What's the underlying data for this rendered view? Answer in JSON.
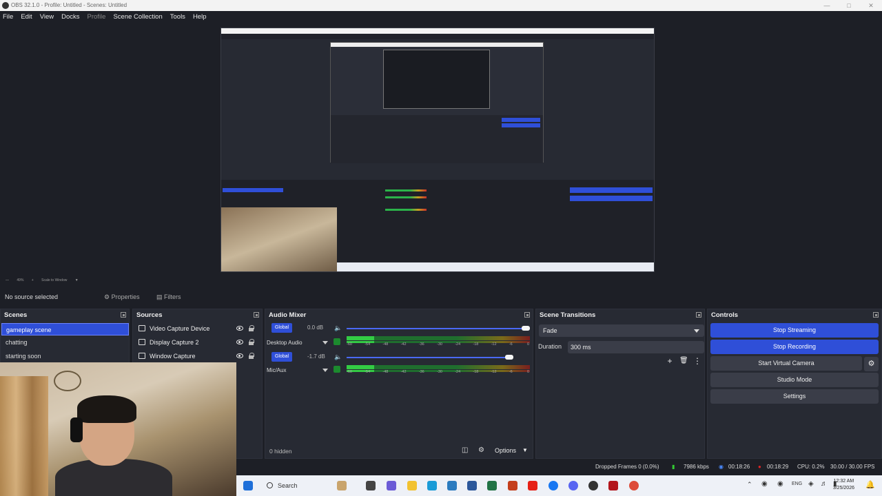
{
  "window": {
    "title": "OBS 32.1.0 - Profile: Untitled - Scenes: Untitled"
  },
  "menu": {
    "file": "File",
    "edit": "Edit",
    "view": "View",
    "docks": "Docks",
    "profile": "Profile",
    "scene_collection": "Scene Collection",
    "tools": "Tools",
    "help": "Help"
  },
  "zoom": {
    "level": "49%",
    "scale_mode": "Scale to Window"
  },
  "context": {
    "no_source": "No source selected",
    "properties": "Properties",
    "filters": "Filters"
  },
  "scenes": {
    "title": "Scenes",
    "items": [
      "gameplay scene",
      "chatting",
      "starting soon"
    ],
    "selected": "gameplay scene"
  },
  "sources": {
    "title": "Sources",
    "items": [
      "Video Capture Device",
      "Display Capture 2",
      "Window Capture"
    ]
  },
  "mixer": {
    "title": "Audio Mixer",
    "channels": [
      {
        "name": "Desktop Audio",
        "badge": "Global",
        "db": "0.0 dB",
        "volume_fraction": 1.0,
        "level_fraction": 0.15
      },
      {
        "name": "Mic/Aux",
        "badge": "Global",
        "db": "-1.7 dB",
        "volume_fraction": 0.89,
        "level_fraction": 0.15
      }
    ],
    "ticks": [
      "-60",
      "-54",
      "-48",
      "-42",
      "-36",
      "-30",
      "-24",
      "-18",
      "-12",
      "-6",
      "0"
    ],
    "hidden": "0 hidden",
    "options": "Options"
  },
  "transitions": {
    "title": "Scene Transitions",
    "selected": "Fade",
    "duration_label": "Duration",
    "duration_value": "300 ms"
  },
  "controls": {
    "title": "Controls",
    "stop_streaming": "Stop Streaming",
    "stop_recording": "Stop Recording",
    "start_virtual_camera": "Start Virtual Camera",
    "studio_mode": "Studio Mode",
    "settings": "Settings"
  },
  "status": {
    "dropped_frames": "Dropped Frames 0 (0.0%)",
    "bitrate": "7986 kbps",
    "stream_time": "00:18:26",
    "record_time": "00:18:29",
    "cpu": "CPU: 0.2%",
    "fps": "30.00 / 30.00 FPS"
  },
  "taskbar": {
    "search": "Search",
    "lang": "ENG",
    "time": "12:32 AM",
    "date": "3/25/2026"
  },
  "colors": {
    "accent": "#2f4fd8",
    "background": "#1d1f26",
    "panel": "#272a33"
  }
}
